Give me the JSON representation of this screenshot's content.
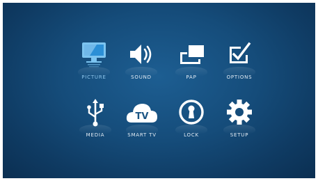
{
  "menu": {
    "items": [
      {
        "label": "PICTURE",
        "icon": "monitor-icon",
        "selected": true
      },
      {
        "label": "SOUND",
        "icon": "speaker-icon",
        "selected": false
      },
      {
        "label": "PAP",
        "icon": "pap-icon",
        "selected": false
      },
      {
        "label": "OPTIONS",
        "icon": "checkbox-icon",
        "selected": false
      },
      {
        "label": "MEDIA",
        "icon": "usb-icon",
        "selected": false
      },
      {
        "label": "SMART TV",
        "icon": "cloud-tv-icon",
        "selected": false,
        "icon_text": "TV"
      },
      {
        "label": "LOCK",
        "icon": "keyhole-icon",
        "selected": false
      },
      {
        "label": "SETUP",
        "icon": "gear-icon",
        "selected": false
      }
    ]
  },
  "colors": {
    "background_center": "#1d5e92",
    "background_edge": "#0b2f52",
    "icon": "#ffffff",
    "selected_icon": "#6ab7ec",
    "label": "#e6eef6",
    "selected_label": "#8fc6ec"
  }
}
